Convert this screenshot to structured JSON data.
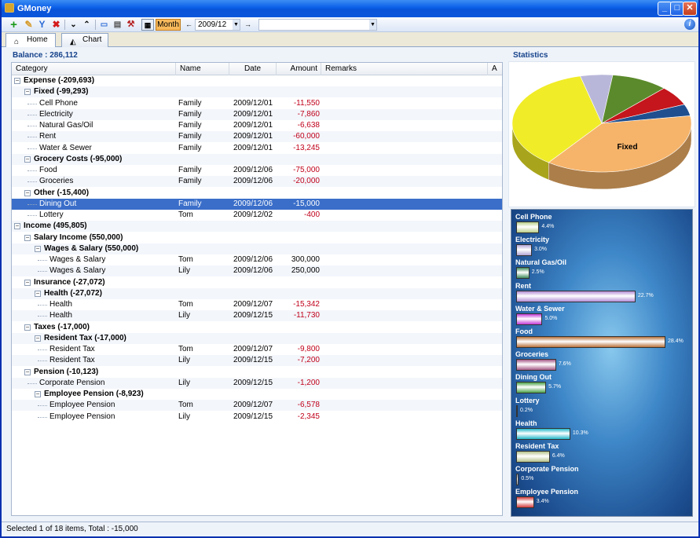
{
  "window": {
    "title": "GMoney"
  },
  "toolbar": {
    "month_label": "Month",
    "date_value": "2009/12",
    "filter_value": ""
  },
  "tabs": [
    {
      "label": "Home"
    },
    {
      "label": "Chart"
    }
  ],
  "balance": "Balance : 286,112",
  "columns": {
    "category": "Category",
    "name": "Name",
    "date": "Date",
    "amount": "Amount",
    "remarks": "Remarks",
    "a": "A"
  },
  "rows": [
    {
      "text": "Expense (-209,693)",
      "level": 0,
      "group": true,
      "name": "",
      "date": "",
      "amount": ""
    },
    {
      "text": "Fixed (-99,293)",
      "level": 1,
      "group": true,
      "name": "",
      "date": "",
      "amount": ""
    },
    {
      "text": "Cell Phone",
      "level": 2,
      "group": false,
      "name": "Family",
      "date": "2009/12/01",
      "amount": "-11,550"
    },
    {
      "text": "Electricity",
      "level": 2,
      "group": false,
      "name": "Family",
      "date": "2009/12/01",
      "amount": "-7,860"
    },
    {
      "text": "Natural Gas/Oil",
      "level": 2,
      "group": false,
      "name": "Family",
      "date": "2009/12/01",
      "amount": "-6,638"
    },
    {
      "text": "Rent",
      "level": 2,
      "group": false,
      "name": "Family",
      "date": "2009/12/01",
      "amount": "-60,000"
    },
    {
      "text": "Water & Sewer",
      "level": 2,
      "group": false,
      "name": "Family",
      "date": "2009/12/01",
      "amount": "-13,245"
    },
    {
      "text": "Grocery Costs (-95,000)",
      "level": 1,
      "group": true,
      "name": "",
      "date": "",
      "amount": ""
    },
    {
      "text": "Food",
      "level": 2,
      "group": false,
      "name": "Family",
      "date": "2009/12/06",
      "amount": "-75,000"
    },
    {
      "text": "Groceries",
      "level": 2,
      "group": false,
      "name": "Family",
      "date": "2009/12/06",
      "amount": "-20,000"
    },
    {
      "text": "Other (-15,400)",
      "level": 1,
      "group": true,
      "name": "",
      "date": "",
      "amount": ""
    },
    {
      "text": "Dining Out",
      "level": 2,
      "group": false,
      "name": "Family",
      "date": "2009/12/06",
      "amount": "-15,000",
      "selected": true
    },
    {
      "text": "Lottery",
      "level": 2,
      "group": false,
      "name": "Tom",
      "date": "2009/12/02",
      "amount": "-400"
    },
    {
      "text": "Income (495,805)",
      "level": 0,
      "group": true,
      "name": "",
      "date": "",
      "amount": ""
    },
    {
      "text": "Salary Income (550,000)",
      "level": 1,
      "group": true,
      "name": "",
      "date": "",
      "amount": ""
    },
    {
      "text": "Wages & Salary (550,000)",
      "level": 2,
      "group": true,
      "name": "",
      "date": "",
      "amount": ""
    },
    {
      "text": "Wages & Salary",
      "level": 3,
      "group": false,
      "name": "Tom",
      "date": "2009/12/06",
      "amount": "300,000",
      "positive": true
    },
    {
      "text": "Wages & Salary",
      "level": 3,
      "group": false,
      "name": "Lily",
      "date": "2009/12/06",
      "amount": "250,000",
      "positive": true
    },
    {
      "text": "Insurance (-27,072)",
      "level": 1,
      "group": true,
      "name": "",
      "date": "",
      "amount": ""
    },
    {
      "text": "Health (-27,072)",
      "level": 2,
      "group": true,
      "name": "",
      "date": "",
      "amount": ""
    },
    {
      "text": "Health",
      "level": 3,
      "group": false,
      "name": "Tom",
      "date": "2009/12/07",
      "amount": "-15,342"
    },
    {
      "text": "Health",
      "level": 3,
      "group": false,
      "name": "Lily",
      "date": "2009/12/15",
      "amount": "-11,730"
    },
    {
      "text": "Taxes (-17,000)",
      "level": 1,
      "group": true,
      "name": "",
      "date": "",
      "amount": ""
    },
    {
      "text": "Resident Tax (-17,000)",
      "level": 2,
      "group": true,
      "name": "",
      "date": "",
      "amount": ""
    },
    {
      "text": "Resident Tax",
      "level": 3,
      "group": false,
      "name": "Tom",
      "date": "2009/12/07",
      "amount": "-9,800"
    },
    {
      "text": "Resident Tax",
      "level": 3,
      "group": false,
      "name": "Lily",
      "date": "2009/12/15",
      "amount": "-7,200"
    },
    {
      "text": "Pension (-10,123)",
      "level": 1,
      "group": true,
      "name": "",
      "date": "",
      "amount": ""
    },
    {
      "text": "Corporate Pension",
      "level": 2,
      "group": false,
      "name": "Lily",
      "date": "2009/12/15",
      "amount": "-1,200"
    },
    {
      "text": "Employee Pension (-8,923)",
      "level": 2,
      "group": true,
      "name": "",
      "date": "",
      "amount": ""
    },
    {
      "text": "Employee Pension",
      "level": 3,
      "group": false,
      "name": "Tom",
      "date": "2009/12/07",
      "amount": "-6,578"
    },
    {
      "text": "Employee Pension",
      "level": 3,
      "group": false,
      "name": "Lily",
      "date": "2009/12/15",
      "amount": "-2,345"
    }
  ],
  "statistics": {
    "title": "Statistics",
    "pie_label": "Fixed",
    "pie_slices": [
      {
        "label": "Fixed",
        "value": 99293,
        "color": "#f6b46a"
      },
      {
        "label": "Grocery Costs",
        "value": 95000,
        "color": "#f0ec28"
      },
      {
        "label": "",
        "value": 15400,
        "color": "#b9b7d9"
      },
      {
        "label": "",
        "value": 27072,
        "color": "#5b8a2c"
      },
      {
        "label": "",
        "value": 17000,
        "color": "#c4161c"
      },
      {
        "label": "",
        "value": 10123,
        "color": "#1f4f8f"
      }
    ],
    "bars": [
      {
        "label": "Cell Phone",
        "value": 4.4,
        "pct": "4.4%",
        "color": "#b9cf8a"
      },
      {
        "label": "Electricity",
        "value": 3.0,
        "pct": "3.0%",
        "color": "#b3a6d8"
      },
      {
        "label": "Natural Gas/Oil",
        "value": 2.5,
        "pct": "2.5%",
        "color": "#3f8a5a"
      },
      {
        "label": "Rent",
        "value": 22.7,
        "pct": "22.7%",
        "color": "#b38ed6"
      },
      {
        "label": "Water & Sewer",
        "value": 5.0,
        "pct": "5.0%",
        "color": "#c23ad6"
      },
      {
        "label": "Food",
        "value": 28.4,
        "pct": "28.4%",
        "color": "#b8713a"
      },
      {
        "label": "Groceries",
        "value": 7.6,
        "pct": "7.6%",
        "color": "#a55a88"
      },
      {
        "label": "Dining Out",
        "value": 5.7,
        "pct": "5.7%",
        "color": "#4aa248"
      },
      {
        "label": "Lottery",
        "value": 0.2,
        "pct": "0.2%",
        "color": "#7ab"
      },
      {
        "label": "Health",
        "value": 10.3,
        "pct": "10.3%",
        "color": "#22b6c8"
      },
      {
        "label": "Resident Tax",
        "value": 6.4,
        "pct": "6.4%",
        "color": "#b6c28a"
      },
      {
        "label": "Corporate Pension",
        "value": 0.5,
        "pct": "0.5%",
        "color": "#8899aa"
      },
      {
        "label": "Employee Pension",
        "value": 3.4,
        "pct": "3.4%",
        "color": "#d23a3a"
      }
    ]
  },
  "status": "Selected 1 of 18 items, Total : -15,000"
}
